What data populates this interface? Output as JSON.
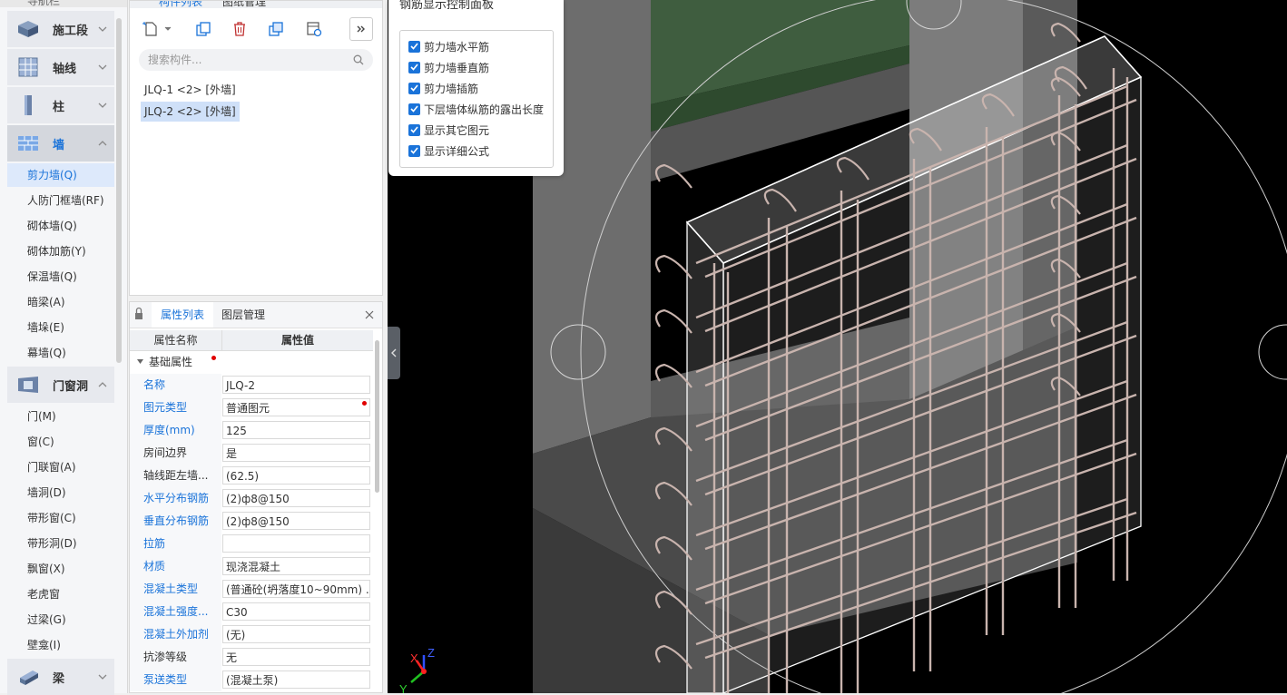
{
  "nav": {
    "header": "导航栏",
    "categories": [
      {
        "label": "施工段",
        "icon": "construction-stage-icon"
      },
      {
        "label": "轴线",
        "icon": "axis-grid-icon"
      },
      {
        "label": "柱",
        "icon": "column-icon"
      },
      {
        "label": "墙",
        "icon": "wall-icon"
      },
      {
        "label": "门窗洞",
        "icon": "door-window-icon"
      },
      {
        "label": "梁",
        "icon": "beam-icon"
      }
    ],
    "wall_items": [
      "剪力墙(Q)",
      "人防门框墙(RF)",
      "砌体墙(Q)",
      "砌体加筋(Y)",
      "保温墙(Q)",
      "暗梁(A)",
      "墙垛(E)",
      "幕墙(Q)"
    ],
    "opening_items": [
      "门(M)",
      "窗(C)",
      "门联窗(A)",
      "墙洞(D)",
      "带形窗(C)",
      "带形洞(D)",
      "飘窗(X)",
      "老虎窗",
      "过梁(G)",
      "壁龛(I)"
    ]
  },
  "component_list": {
    "tabs": [
      "构件列表",
      "图纸管理"
    ],
    "search_placeholder": "搜索构件...",
    "items": [
      "JLQ-1 <2> [外墙]",
      "JLQ-2 <2> [外墙]"
    ]
  },
  "properties": {
    "tabs": [
      "属性列表",
      "图层管理"
    ],
    "col_name": "属性名称",
    "col_value": "属性值",
    "group": "基础属性",
    "rows": [
      {
        "name": "名称",
        "value": "JLQ-2"
      },
      {
        "name": "图元类型",
        "value": "普通图元"
      },
      {
        "name": "厚度(mm)",
        "value": "125"
      },
      {
        "name": "房间边界",
        "value": "是"
      },
      {
        "name": "轴线距左墙...",
        "value": "(62.5)"
      },
      {
        "name": "水平分布钢筋",
        "value": "(2)ф8@150"
      },
      {
        "name": "垂直分布钢筋",
        "value": "(2)ф8@150"
      },
      {
        "name": "拉筋",
        "value": ""
      },
      {
        "name": "材质",
        "value": "现浇混凝土"
      },
      {
        "name": "混凝土类型",
        "value": "(普通砼(坍落度10~90mm) ..."
      },
      {
        "name": "混凝土强度...",
        "value": "C30"
      },
      {
        "name": "混凝土外加剂",
        "value": "(无)"
      },
      {
        "name": "抗渗等级",
        "value": "无"
      },
      {
        "name": "泵送类型",
        "value": "(混凝土泵)"
      }
    ]
  },
  "rebar_panel": {
    "title": "钢筋显示控制面板",
    "options": [
      "剪力墙水平筋",
      "剪力墙垂直筋",
      "剪力墙插筋",
      "下层墙体纵筋的露出长度",
      "显示其它图元",
      "显示详细公式"
    ]
  },
  "axis": {
    "x": "X",
    "y": "Y",
    "z": "Z"
  }
}
